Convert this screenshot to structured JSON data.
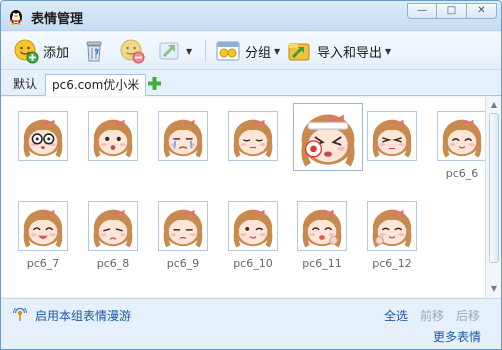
{
  "window": {
    "title": "表情管理",
    "controls": [
      "—",
      "□",
      "✕"
    ]
  },
  "toolbar": {
    "add_label": "添加",
    "group_label": "分组",
    "import_export_label": "导入和导出"
  },
  "tabs": [
    {
      "label": "默认",
      "active": false
    },
    {
      "label": "pc6.com优小米",
      "active": true
    }
  ],
  "emoticons": [
    {
      "label": "",
      "face": "glasses"
    },
    {
      "label": "",
      "face": "surprised"
    },
    {
      "label": "",
      "face": "cry"
    },
    {
      "label": "",
      "face": "sleepy"
    },
    {
      "label": "",
      "face": "hurt",
      "selected": true
    },
    {
      "label": "",
      "face": "squint"
    },
    {
      "label": "pc6_6",
      "face": "happy"
    },
    {
      "label": "pc6_7",
      "face": "laugh"
    },
    {
      "label": "pc6_8",
      "face": "sad"
    },
    {
      "label": "pc6_9",
      "face": "upset"
    },
    {
      "label": "pc6_10",
      "face": "wink"
    },
    {
      "label": "pc6_11",
      "face": "cheer"
    },
    {
      "label": "pc6_12",
      "face": "giggle"
    }
  ],
  "footer": {
    "roam_label": "启用本组表情漫游",
    "select_all": "全选",
    "move_forward": "前移",
    "move_back": "后移",
    "more_emoticons": "更多表情"
  },
  "colors": {
    "link": "#1f57a8",
    "disabled": "#9aa7b5",
    "hair": "#c98a4f",
    "bow": "#e96b78"
  }
}
